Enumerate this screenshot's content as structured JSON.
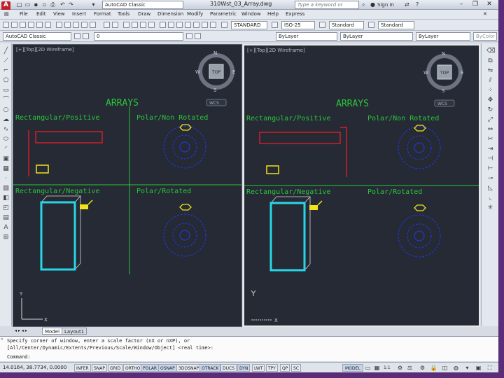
{
  "window": {
    "doc_title": "310Wst_03_Array.dwg",
    "workspace": "AutoCAD Classic",
    "search_placeholder": "Type a keyword or phrase",
    "sign_in": "Sign In"
  },
  "menubar": [
    "File",
    "Edit",
    "View",
    "Insert",
    "Format",
    "Tools",
    "Draw",
    "Dimension",
    "Modify",
    "Parametric",
    "Window",
    "Help",
    "Express"
  ],
  "toolbar2": {
    "workspace_combo": "AutoCAD Classic",
    "text_style": "STANDARD",
    "dim_style": "ISO-25",
    "table_style": "Standard",
    "multileader_style": "Standard"
  },
  "toolbar3": {
    "layer_combo": "0",
    "color_combo": "ByLayer",
    "linetype_combo": "ByLayer",
    "lineweight_combo": "ByLayer",
    "plotstyle_combo": "ByColor"
  },
  "viewports": {
    "left": {
      "label": "[+][Top][2D Wireframe]",
      "title": "ARRAYS",
      "q1": "Rectangular/Positive",
      "q2": "Polar/Non Rotated",
      "q3": "Rectangular/Negative",
      "q4": "Polar/Rotated",
      "wcs": "WCS"
    },
    "right": {
      "label": "[+][Top][2D Wireframe]",
      "title": "ARRAYS",
      "q1": "Rectangular/Positive",
      "q2": "Polar/Non Rotated",
      "q3": "Rectangular/Negative",
      "q4": "Polar/Rotated",
      "wcs": "WCS"
    }
  },
  "viewcube": {
    "n": "N",
    "s": "S",
    "e": "E",
    "w": "W",
    "face": "TOP"
  },
  "ucs": {
    "x": "X",
    "y": "Y"
  },
  "layout_tabs": [
    "Model",
    "Layout1"
  ],
  "command": {
    "line1": "Specify corner of window, enter a scale factor (nX or nXP), or",
    "line2": "[All/Center/Dynamic/Extents/Previous/Scale/Window/Object] <real time>:",
    "line3": "Command:"
  },
  "status": {
    "coords": "14.0164, 38.7734, 0.0000",
    "buttons": [
      "INFER",
      "SNAP",
      "GRID",
      "ORTHO",
      "POLAR",
      "OSNAP",
      "3DOSNAP",
      "OTRACK",
      "DUCS",
      "DYN",
      "LWT",
      "TPY",
      "QP",
      "SC"
    ],
    "model": "MODEL",
    "scale": "1:1"
  },
  "colors": {
    "viewport_bg": "#252a35",
    "text_green": "#2bc53b",
    "red": "#d21e2a",
    "yellow": "#f2e31a",
    "cyan": "#29d6e8",
    "blue": "#2238c8",
    "frame": "#5b2d78"
  }
}
